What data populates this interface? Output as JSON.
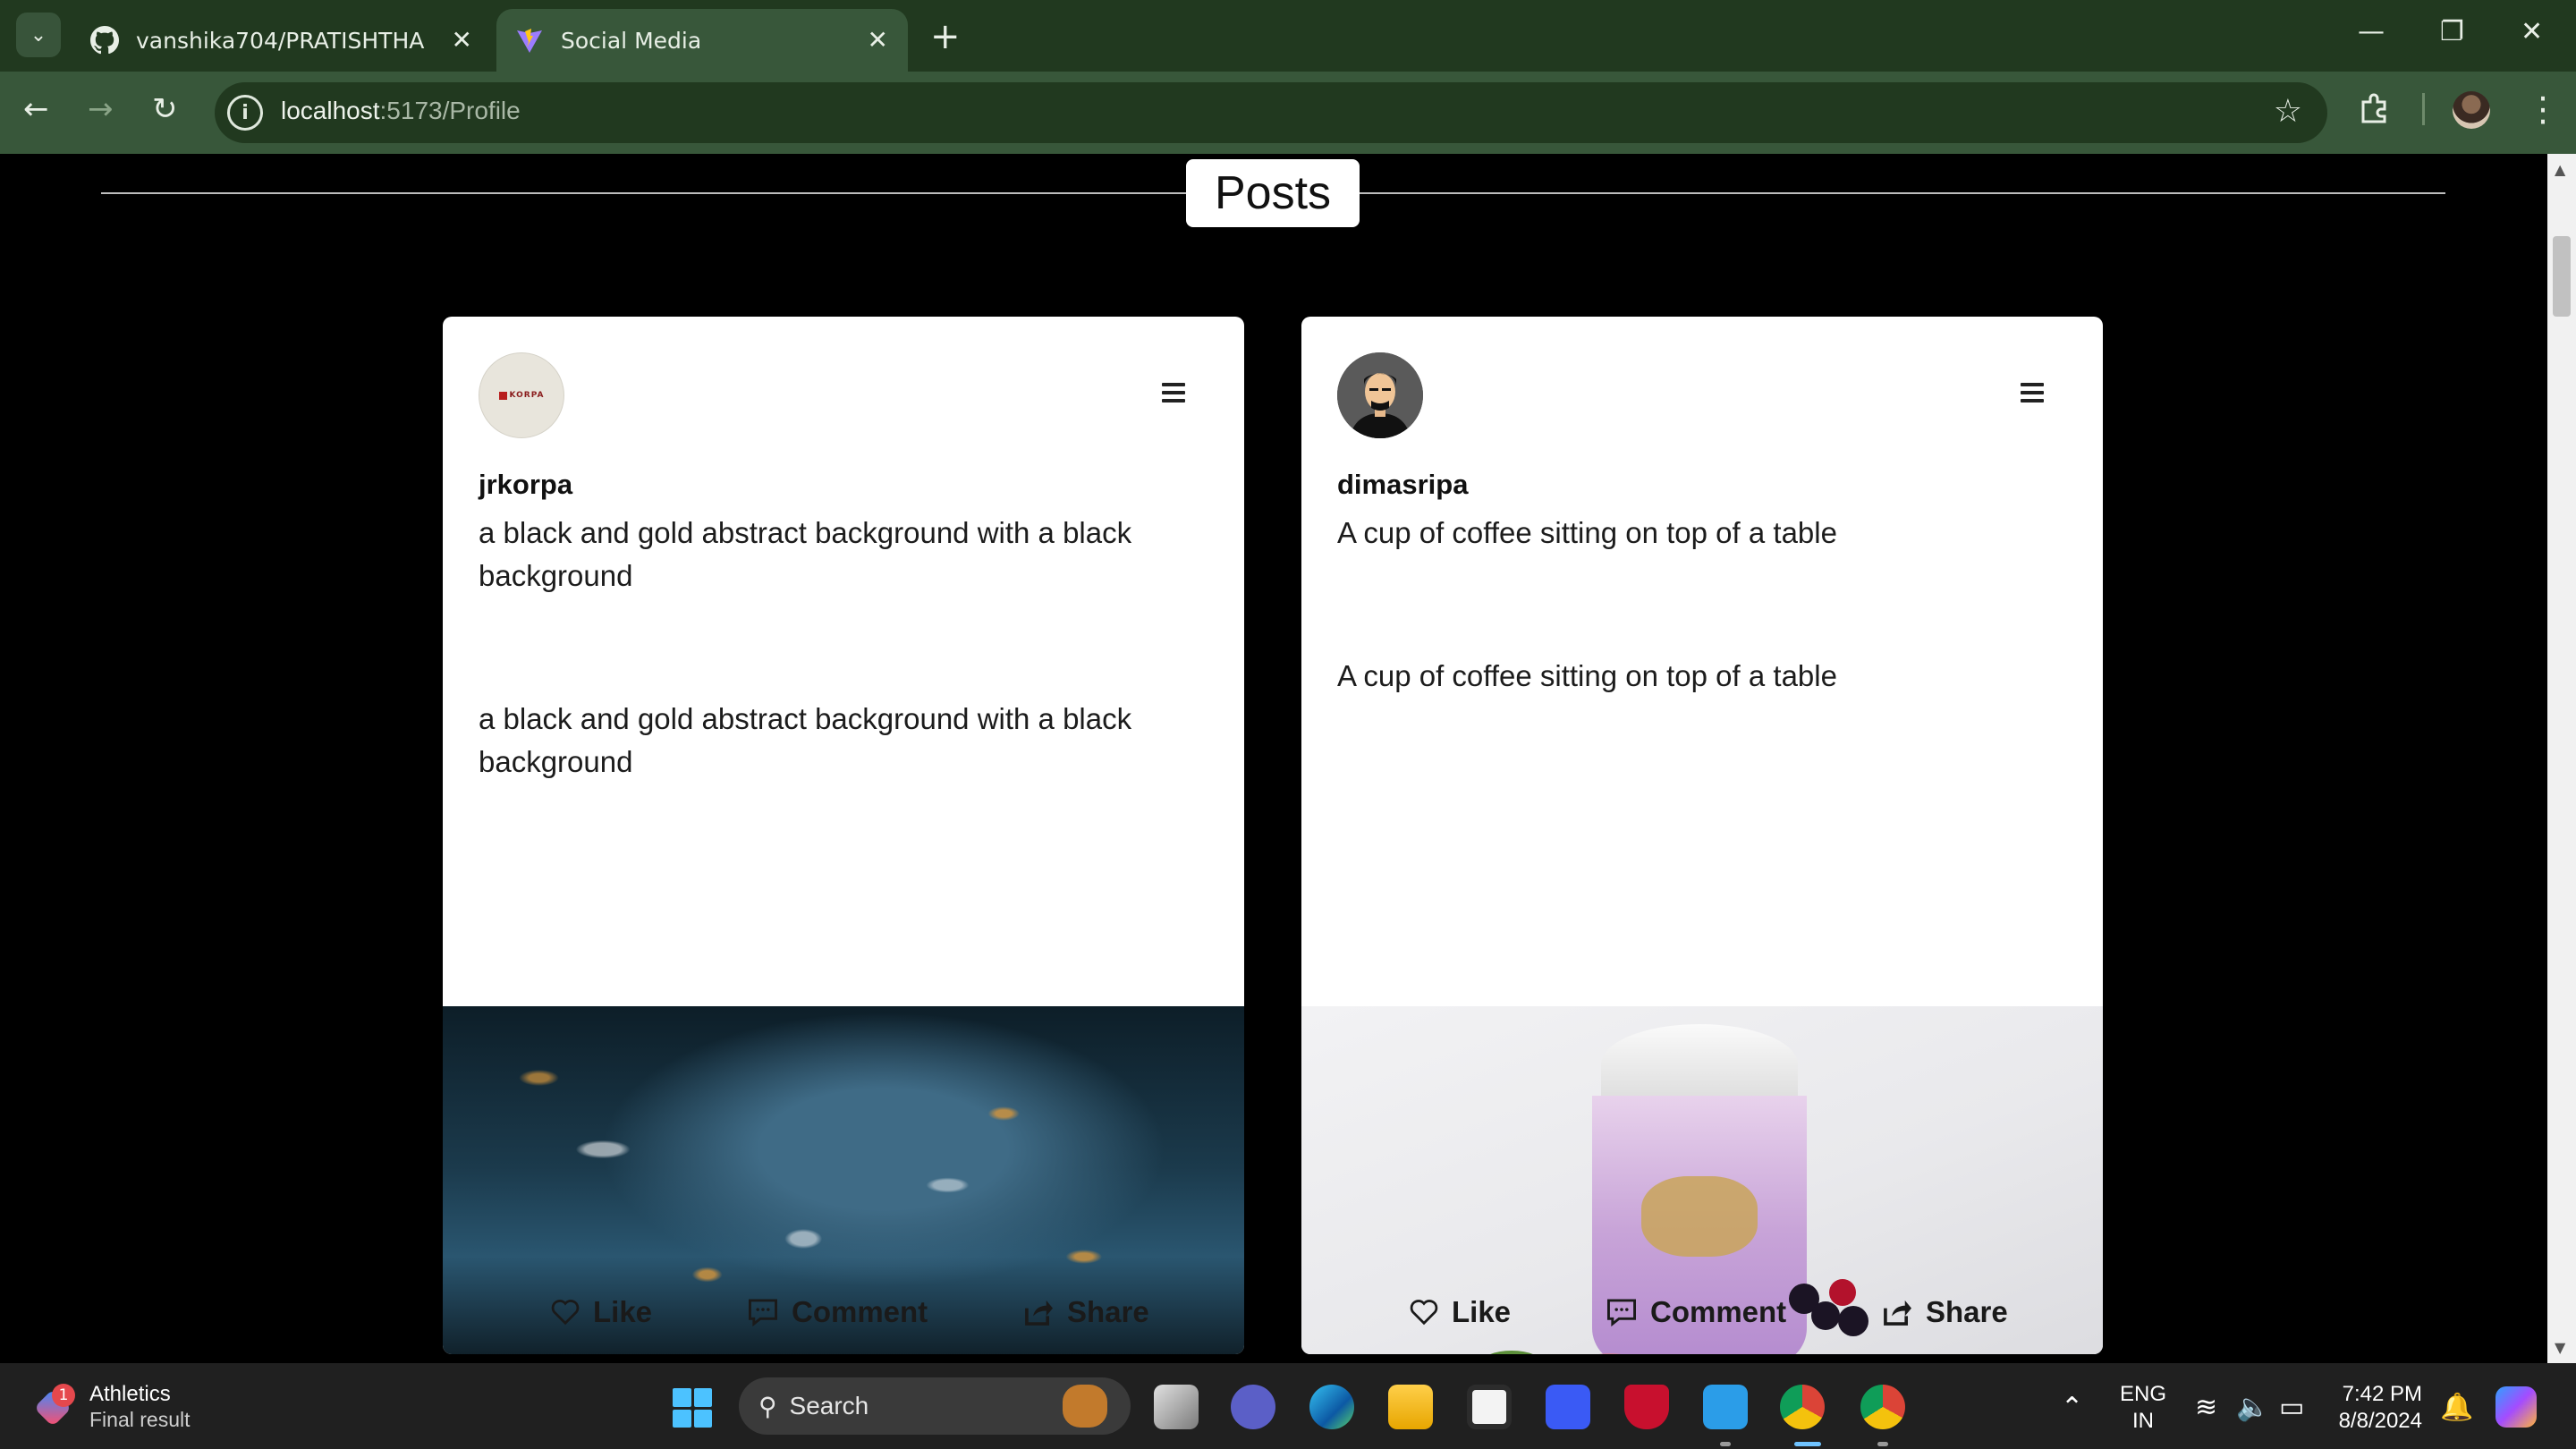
{
  "browser": {
    "tabs": [
      {
        "title": "vanshika704/PRATISHTHA",
        "icon": "github-icon"
      },
      {
        "title": "Social Media",
        "icon": "vite-icon",
        "active": true
      }
    ],
    "address": {
      "host": "localhost",
      "path": ":5173/Profile"
    }
  },
  "page": {
    "section_title": "Posts",
    "posts": [
      {
        "username": "jrkorpa",
        "avatar_text": "KORPA",
        "caption": "a black and gold abstract background with a black background",
        "description": "a black and gold abstract background with a black background",
        "image": "abstract-blue-gold-image"
      },
      {
        "username": "dimasripa",
        "caption": "A cup of coffee sitting on top of a table",
        "description": "A cup of coffee sitting on top of a table",
        "image": "purple-drink-cup-image"
      }
    ],
    "actions": {
      "like": "Like",
      "comment": "Comment",
      "share": "Share"
    }
  },
  "taskbar": {
    "widget_title": "Athletics",
    "widget_sub": "Final result",
    "widget_badge": "1",
    "search_placeholder": "Search",
    "lang_top": "ENG",
    "lang_bottom": "IN",
    "time": "7:42 PM",
    "date": "8/8/2024"
  },
  "colors": {
    "chrome_dark": "#21391f",
    "chrome_light": "#38573a",
    "page_bg": "#000000",
    "card_bg": "#ffffff"
  }
}
